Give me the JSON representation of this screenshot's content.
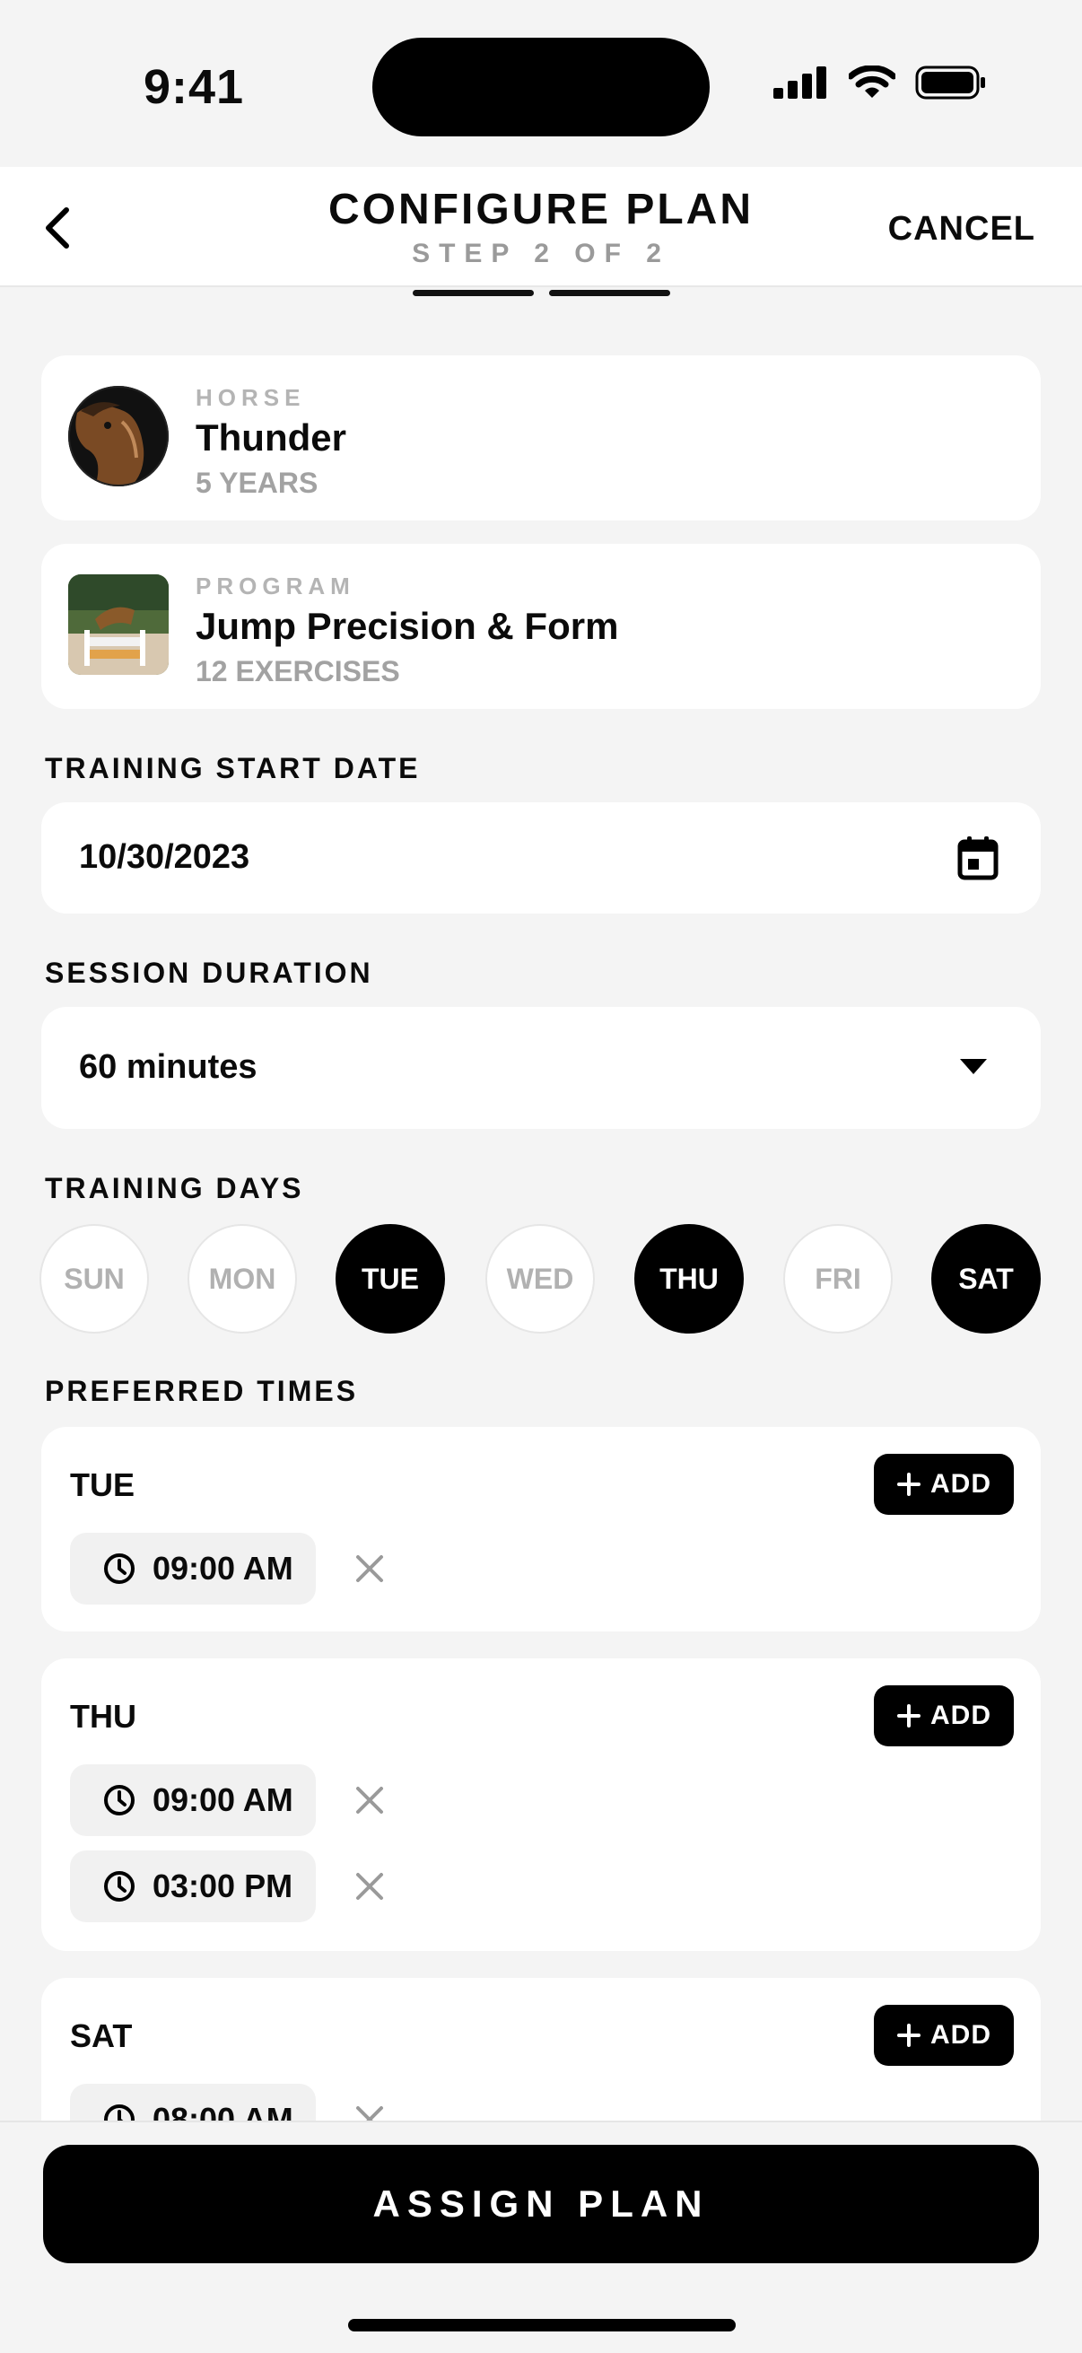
{
  "status": {
    "time": "9:41"
  },
  "header": {
    "title": "CONFIGURE PLAN",
    "step": "STEP 2 OF 2",
    "cancel": "CANCEL",
    "progress_steps_completed": 2,
    "progress_steps_total": 2
  },
  "horse": {
    "kicker": "HORSE",
    "name": "Thunder",
    "age": "5 YEARS"
  },
  "program": {
    "kicker": "PROGRAM",
    "name": "Jump Precision & Form",
    "exercises": "12 EXERCISES"
  },
  "start_date": {
    "label": "TRAINING START DATE",
    "value": "10/30/2023"
  },
  "duration": {
    "label": "SESSION DURATION",
    "value": "60 minutes"
  },
  "days": {
    "label": "TRAINING DAYS",
    "items": [
      {
        "label": "SUN",
        "selected": false
      },
      {
        "label": "MON",
        "selected": false
      },
      {
        "label": "TUE",
        "selected": true
      },
      {
        "label": "WED",
        "selected": false
      },
      {
        "label": "THU",
        "selected": true
      },
      {
        "label": "FRI",
        "selected": false
      },
      {
        "label": "SAT",
        "selected": true
      }
    ]
  },
  "times": {
    "label": "PREFERRED TIMES",
    "add_label": "ADD",
    "groups": [
      {
        "day": "TUE",
        "slots": [
          "09:00 AM"
        ]
      },
      {
        "day": "THU",
        "slots": [
          "09:00 AM",
          "03:00 PM"
        ]
      },
      {
        "day": "SAT",
        "slots": [
          "08:00 AM"
        ]
      }
    ]
  },
  "assign_button": "ASSIGN PLAN",
  "colors": {
    "accent": "#000000",
    "background": "#f4f4f4",
    "muted": "#a2a2a2"
  }
}
